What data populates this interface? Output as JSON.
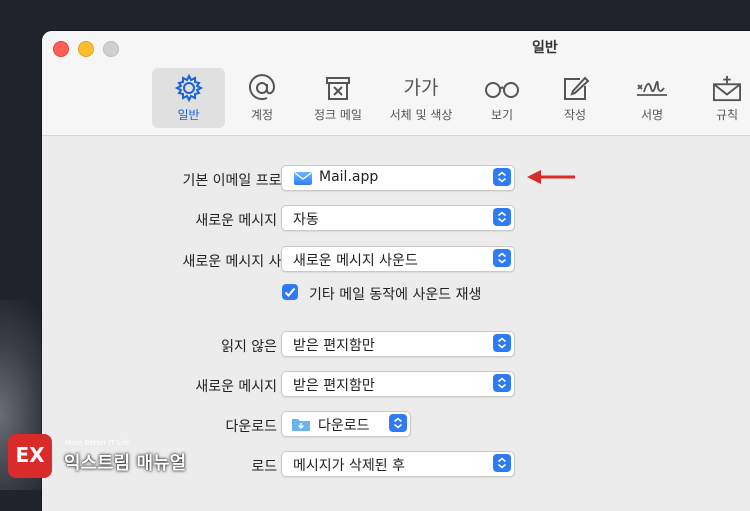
{
  "window": {
    "title": "일반"
  },
  "tabs": [
    {
      "label": "일반",
      "icon": "gear-icon",
      "active": true
    },
    {
      "label": "계정",
      "icon": "at-icon"
    },
    {
      "label": "정크 메일",
      "icon": "junk-bin-icon"
    },
    {
      "label": "서체 및 색상",
      "icon": "font-icon",
      "glyph": "가가"
    },
    {
      "label": "보기",
      "icon": "glasses-icon"
    },
    {
      "label": "작성",
      "icon": "compose-icon"
    },
    {
      "label": "서명",
      "icon": "signature-icon"
    },
    {
      "label": "규칙",
      "icon": "rules-envelope-icon"
    }
  ],
  "settings": {
    "default_mail": {
      "label": "기본 이메일 프로그램:",
      "value": "Mail.app",
      "icon": "mail-app-icon"
    },
    "check_new": {
      "label": "새로운 메시지 확인:",
      "value": "자동"
    },
    "new_sound": {
      "label": "새로운 메시지 사운드:",
      "value": "새로운 메시지 사운드"
    },
    "other_sounds": {
      "label": "기타 메일 동작에 사운드 재생",
      "checked": true
    },
    "unread_count": {
      "label": "읽지 않은 개수:",
      "value": "받은 편지함만"
    },
    "new_notify": {
      "label": "새로운 메시지 알림:",
      "value": "받은 편지함만"
    },
    "download_folder": {
      "label": "다운로드 폴더:",
      "value": "다운로드",
      "icon": "downloads-folder-icon"
    },
    "remove_downloads": {
      "label": "로드 제거:",
      "value": "메시지가 삭제된 후"
    }
  },
  "watermark": {
    "logo": "EX",
    "tagline": "More Better IT Life",
    "name": "익스트림 매뉴얼"
  },
  "colors": {
    "accent": "#2f7bf5",
    "arrow": "#d92b2b"
  }
}
